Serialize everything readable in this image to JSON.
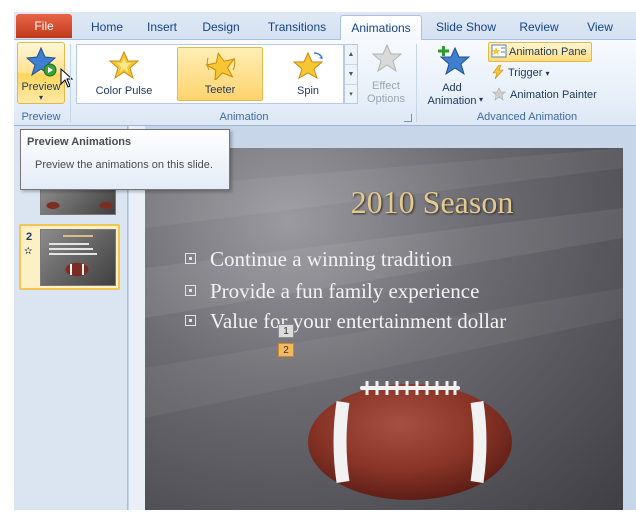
{
  "tabs": [
    {
      "label": "File"
    },
    {
      "label": "Home"
    },
    {
      "label": "Insert"
    },
    {
      "label": "Design"
    },
    {
      "label": "Transitions"
    },
    {
      "label": "Animations"
    },
    {
      "label": "Slide Show"
    },
    {
      "label": "Review"
    },
    {
      "label": "View"
    }
  ],
  "ribbon": {
    "preview_group": {
      "button_label": "Preview",
      "group_label": "Preview"
    },
    "animation_group": {
      "gallery": [
        {
          "label": "Color Pulse",
          "icon": "color-pulse-star-icon"
        },
        {
          "label": "Teeter",
          "icon": "teeter-star-icon",
          "selected": true
        },
        {
          "label": "Spin",
          "icon": "spin-star-icon"
        }
      ],
      "effect_options_line1": "Effect",
      "effect_options_line2": "Options",
      "group_label": "Animation"
    },
    "advanced_group": {
      "add_animation_line1": "Add",
      "add_animation_line2": "Animation",
      "animation_pane": "Animation Pane",
      "trigger": "Trigger",
      "animation_painter": "Animation Painter",
      "group_label": "Advanced Animation"
    }
  },
  "tooltip": {
    "title": "Preview Animations",
    "body": "Preview the animations on this slide."
  },
  "slide_panel": {
    "selected_slide_number": "2"
  },
  "slide": {
    "title": "2010 Season",
    "bullets": [
      "Continue a winning tradition",
      "Provide a fun family experience",
      "Value for your entertainment dollar"
    ],
    "animation_tags": [
      "1",
      "2"
    ]
  },
  "colors": {
    "file_tab": "#c23a1b",
    "title_gold": "#e4c98e",
    "highlight": "#ffd36e"
  }
}
